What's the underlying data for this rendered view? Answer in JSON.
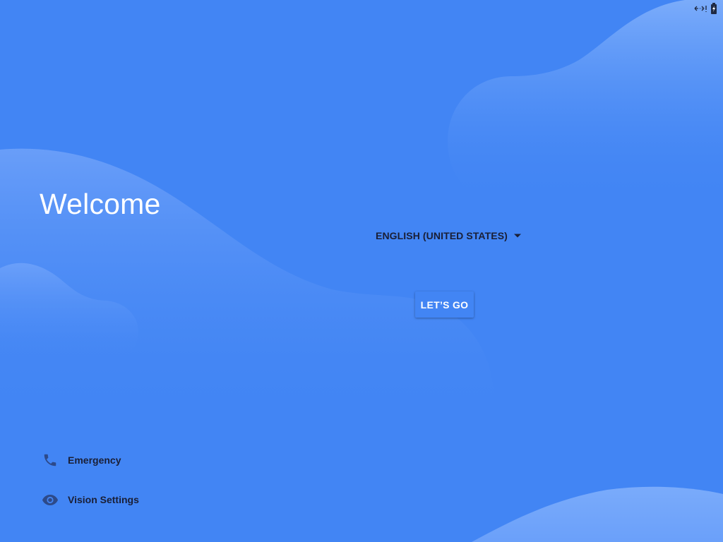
{
  "colors": {
    "background": "#4285f4",
    "wave_light": "#7aabfb",
    "text_dark": "#1a1f36",
    "icon_dark": "#2d4a8a"
  },
  "status_bar": {
    "icons": [
      "network-transfer-icon",
      "battery-charging-icon"
    ]
  },
  "welcome": {
    "title": "Welcome"
  },
  "language": {
    "selected": "ENGLISH (UNITED STATES)",
    "icon": "dropdown-arrow-icon"
  },
  "primary_button": {
    "label": "LET’S GO"
  },
  "bottom_actions": [
    {
      "label": "Emergency",
      "icon": "phone-icon"
    },
    {
      "label": "Vision Settings",
      "icon": "eye-icon"
    }
  ]
}
